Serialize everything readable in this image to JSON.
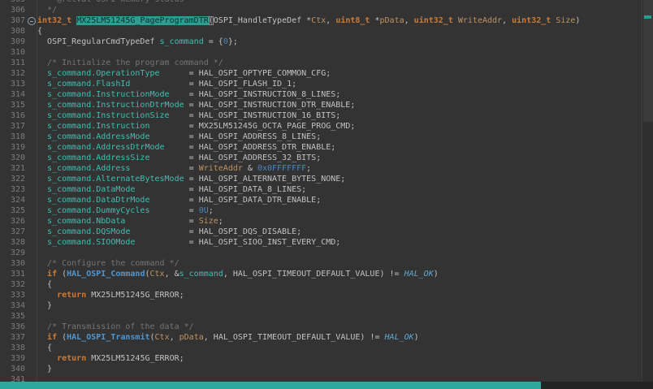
{
  "window": {
    "type": "code-editor",
    "theme": "dark",
    "language": "c"
  },
  "colors": {
    "background": "#333333",
    "gutter_text": "#7c7c7c",
    "plain_text": "#c2c2c2",
    "keyword": "#cc7a35",
    "member_variable": "#3bc0b0",
    "comment": "#747474",
    "number_literal": "#4786c6",
    "parameter": "#be9362",
    "function_call": "#4e96d2",
    "enum_constant": "#5fa8d3",
    "occurrence_highlight_bg": "#2d9d92",
    "occurrence_highlight_text": "#0a2e2b",
    "hscrollbar_thumb": "#2ea89b"
  },
  "editor": {
    "first_line_number": 305,
    "highlighted_symbol": "MX25LM51245G_PageProgramDTR",
    "lines": [
      {
        "n": 305,
        "t": [
          [
            "  * @retval OSPI memory status",
            "c"
          ]
        ]
      },
      {
        "n": 306,
        "t": [
          [
            "  */",
            "c"
          ]
        ]
      },
      {
        "n": 307,
        "fold": true,
        "t": [
          [
            "int32_t",
            "k"
          ],
          [
            " ",
            "p"
          ],
          [
            "MX25LM51245G_PageProgramDTR",
            "hl"
          ],
          [
            "(",
            "br"
          ],
          [
            "OSPI_HandleTypeDef",
            "p"
          ],
          [
            " *",
            "p"
          ],
          [
            "Ctx",
            "a"
          ],
          [
            ", ",
            "p"
          ],
          [
            "uint8_t",
            "k"
          ],
          [
            " *",
            "p"
          ],
          [
            "pData",
            "a"
          ],
          [
            ", ",
            "p"
          ],
          [
            "uint32_t",
            "k"
          ],
          [
            " ",
            "p"
          ],
          [
            "WriteAddr",
            "a"
          ],
          [
            ", ",
            "p"
          ],
          [
            "uint32_t",
            "k"
          ],
          [
            " ",
            "p"
          ],
          [
            "Size",
            "a"
          ],
          [
            ")",
            "p"
          ]
        ]
      },
      {
        "n": 308,
        "t": [
          [
            "{",
            "p"
          ]
        ]
      },
      {
        "n": 309,
        "t": [
          [
            "  ",
            "p"
          ],
          [
            "OSPI_RegularCmdTypeDef",
            "p"
          ],
          [
            " ",
            "p"
          ],
          [
            "s_command",
            "m"
          ],
          [
            " = {",
            "p"
          ],
          [
            "0",
            "n"
          ],
          [
            "};",
            "p"
          ]
        ]
      },
      {
        "n": 310,
        "t": []
      },
      {
        "n": 311,
        "t": [
          [
            "  /* Initialize the program command */",
            "c"
          ]
        ]
      },
      {
        "n": 312,
        "t": [
          [
            "  ",
            "p"
          ],
          [
            "s_command.OperationType",
            "m"
          ],
          [
            "      = ",
            "p"
          ],
          [
            "HAL_OSPI_OPTYPE_COMMON_CFG;",
            "p"
          ]
        ]
      },
      {
        "n": 313,
        "t": [
          [
            "  ",
            "p"
          ],
          [
            "s_command.FlashId",
            "m"
          ],
          [
            "            = ",
            "p"
          ],
          [
            "HAL_OSPI_FLASH_ID_1;",
            "p"
          ]
        ]
      },
      {
        "n": 314,
        "t": [
          [
            "  ",
            "p"
          ],
          [
            "s_command.InstructionMode",
            "m"
          ],
          [
            "    = ",
            "p"
          ],
          [
            "HAL_OSPI_INSTRUCTION_8_LINES;",
            "p"
          ]
        ]
      },
      {
        "n": 315,
        "t": [
          [
            "  ",
            "p"
          ],
          [
            "s_command.InstructionDtrMode",
            "m"
          ],
          [
            " = ",
            "p"
          ],
          [
            "HAL_OSPI_INSTRUCTION_DTR_ENABLE;",
            "p"
          ]
        ]
      },
      {
        "n": 316,
        "t": [
          [
            "  ",
            "p"
          ],
          [
            "s_command.InstructionSize",
            "m"
          ],
          [
            "    = ",
            "p"
          ],
          [
            "HAL_OSPI_INSTRUCTION_16_BITS;",
            "p"
          ]
        ]
      },
      {
        "n": 317,
        "t": [
          [
            "  ",
            "p"
          ],
          [
            "s_command.Instruction",
            "m"
          ],
          [
            "        = ",
            "p"
          ],
          [
            "MX25LM51245G_OCTA_PAGE_PROG_CMD;",
            "p"
          ]
        ]
      },
      {
        "n": 318,
        "t": [
          [
            "  ",
            "p"
          ],
          [
            "s_command.AddressMode",
            "m"
          ],
          [
            "        = ",
            "p"
          ],
          [
            "HAL_OSPI_ADDRESS_8_LINES;",
            "p"
          ]
        ]
      },
      {
        "n": 319,
        "t": [
          [
            "  ",
            "p"
          ],
          [
            "s_command.AddressDtrMode",
            "m"
          ],
          [
            "     = ",
            "p"
          ],
          [
            "HAL_OSPI_ADDRESS_DTR_ENABLE;",
            "p"
          ]
        ]
      },
      {
        "n": 320,
        "t": [
          [
            "  ",
            "p"
          ],
          [
            "s_command.AddressSize",
            "m"
          ],
          [
            "        = ",
            "p"
          ],
          [
            "HAL_OSPI_ADDRESS_32_BITS;",
            "p"
          ]
        ]
      },
      {
        "n": 321,
        "t": [
          [
            "  ",
            "p"
          ],
          [
            "s_command.Address",
            "m"
          ],
          [
            "            = ",
            "p"
          ],
          [
            "WriteAddr",
            "a"
          ],
          [
            " & ",
            "p"
          ],
          [
            "0x0FFFFFFF",
            "n"
          ],
          [
            ";",
            "p"
          ]
        ]
      },
      {
        "n": 322,
        "t": [
          [
            "  ",
            "p"
          ],
          [
            "s_command.AlternateBytesMode",
            "m"
          ],
          [
            " = ",
            "p"
          ],
          [
            "HAL_OSPI_ALTERNATE_BYTES_NONE;",
            "p"
          ]
        ]
      },
      {
        "n": 323,
        "t": [
          [
            "  ",
            "p"
          ],
          [
            "s_command.DataMode",
            "m"
          ],
          [
            "           = ",
            "p"
          ],
          [
            "HAL_OSPI_DATA_8_LINES;",
            "p"
          ]
        ]
      },
      {
        "n": 324,
        "t": [
          [
            "  ",
            "p"
          ],
          [
            "s_command.DataDtrMode",
            "m"
          ],
          [
            "        = ",
            "p"
          ],
          [
            "HAL_OSPI_DATA_DTR_ENABLE;",
            "p"
          ]
        ]
      },
      {
        "n": 325,
        "t": [
          [
            "  ",
            "p"
          ],
          [
            "s_command.DummyCycles",
            "m"
          ],
          [
            "        = ",
            "p"
          ],
          [
            "0U",
            "n"
          ],
          [
            ";",
            "p"
          ]
        ]
      },
      {
        "n": 326,
        "t": [
          [
            "  ",
            "p"
          ],
          [
            "s_command.NbData",
            "m"
          ],
          [
            "             = ",
            "p"
          ],
          [
            "Size",
            "a"
          ],
          [
            ";",
            "p"
          ]
        ]
      },
      {
        "n": 327,
        "t": [
          [
            "  ",
            "p"
          ],
          [
            "s_command.DQSMode",
            "m"
          ],
          [
            "            = ",
            "p"
          ],
          [
            "HAL_OSPI_DQS_DISABLE;",
            "p"
          ]
        ]
      },
      {
        "n": 328,
        "t": [
          [
            "  ",
            "p"
          ],
          [
            "s_command.SIOOMode",
            "m"
          ],
          [
            "           = ",
            "p"
          ],
          [
            "HAL_OSPI_SIOO_INST_EVERY_CMD;",
            "p"
          ]
        ]
      },
      {
        "n": 329,
        "t": []
      },
      {
        "n": 330,
        "t": [
          [
            "  /* Configure the command */",
            "c"
          ]
        ]
      },
      {
        "n": 331,
        "t": [
          [
            "  ",
            "p"
          ],
          [
            "if",
            "k"
          ],
          [
            " (",
            "p"
          ],
          [
            "HAL_OSPI_Command",
            "f"
          ],
          [
            "(",
            "p"
          ],
          [
            "Ctx",
            "a"
          ],
          [
            ", &",
            "p"
          ],
          [
            "s_command",
            "m"
          ],
          [
            ", ",
            "p"
          ],
          [
            "HAL_OSPI_TIMEOUT_DEFAULT_VALUE",
            "p"
          ],
          [
            ") != ",
            "p"
          ],
          [
            "HAL_OK",
            "e"
          ],
          [
            ")",
            "p"
          ]
        ]
      },
      {
        "n": 332,
        "t": [
          [
            "  {",
            "p"
          ]
        ]
      },
      {
        "n": 333,
        "t": [
          [
            "    ",
            "p"
          ],
          [
            "return",
            "k"
          ],
          [
            " ",
            "p"
          ],
          [
            "MX25LM51245G_ERROR;",
            "p"
          ]
        ]
      },
      {
        "n": 334,
        "t": [
          [
            "  }",
            "p"
          ]
        ]
      },
      {
        "n": 335,
        "t": []
      },
      {
        "n": 336,
        "t": [
          [
            "  /* Transmission of the data */",
            "c"
          ]
        ]
      },
      {
        "n": 337,
        "t": [
          [
            "  ",
            "p"
          ],
          [
            "if",
            "k"
          ],
          [
            " (",
            "p"
          ],
          [
            "HAL_OSPI_Transmit",
            "f"
          ],
          [
            "(",
            "p"
          ],
          [
            "Ctx",
            "a"
          ],
          [
            ", ",
            "p"
          ],
          [
            "pData",
            "a"
          ],
          [
            ", ",
            "p"
          ],
          [
            "HAL_OSPI_TIMEOUT_DEFAULT_VALUE",
            "p"
          ],
          [
            ") != ",
            "p"
          ],
          [
            "HAL_OK",
            "e"
          ],
          [
            ")",
            "p"
          ]
        ]
      },
      {
        "n": 338,
        "t": [
          [
            "  {",
            "p"
          ]
        ]
      },
      {
        "n": 339,
        "t": [
          [
            "    ",
            "p"
          ],
          [
            "return",
            "k"
          ],
          [
            " ",
            "p"
          ],
          [
            "MX25LM51245G_ERROR;",
            "p"
          ]
        ]
      },
      {
        "n": 340,
        "t": [
          [
            "  }",
            "p"
          ]
        ]
      },
      {
        "n": 341,
        "t": []
      }
    ]
  }
}
